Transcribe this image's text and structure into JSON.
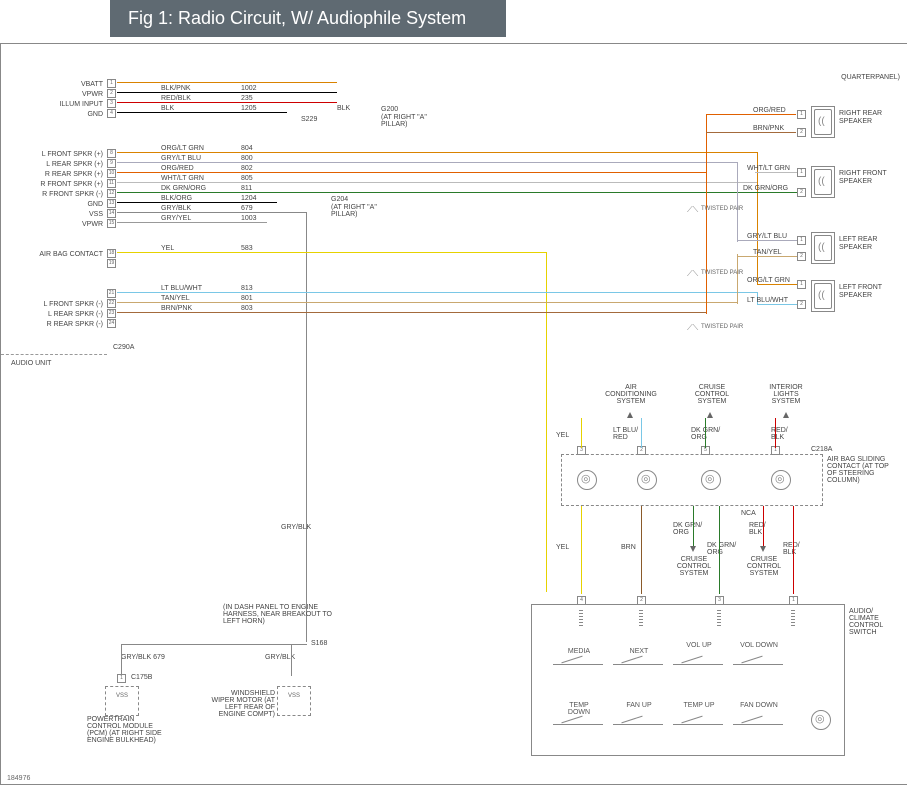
{
  "title": "Fig 1: Radio Circuit, W/ Audiophile System",
  "doc_id": "184976",
  "corner_label": "QUARTERPANEL)",
  "audio_unit_label": "AUDIO UNIT",
  "connector": "C290A",
  "left_pins": [
    {
      "num": "1",
      "name": "VBATT",
      "color": "",
      "code": ""
    },
    {
      "num": "2",
      "name": "VPWR",
      "color": "BLK/PNK",
      "code": "1002"
    },
    {
      "num": "3",
      "name": "ILLUM INPUT",
      "color": "RED/BLK",
      "code": "235"
    },
    {
      "num": "4",
      "name": "GND",
      "color": "BLK",
      "code": "1205"
    },
    {
      "num": "8",
      "name": "L FRONT SPKR (+)",
      "color": "ORG/LT GRN",
      "code": "804"
    },
    {
      "num": "9",
      "name": "L REAR SPKR (+)",
      "color": "GRY/LT BLU",
      "code": "800"
    },
    {
      "num": "10",
      "name": "R REAR SPKR (+)",
      "color": "ORG/RED",
      "code": "802"
    },
    {
      "num": "11",
      "name": "R FRONT SPKR (+)",
      "color": "WHT/LT GRN",
      "code": "805"
    },
    {
      "num": "12",
      "name": "R FRONT SPKR (-)",
      "color": "DK GRN/ORG",
      "code": "811"
    },
    {
      "num": "13",
      "name": "GND",
      "color": "BLK/ORG",
      "code": "1204"
    },
    {
      "num": "14",
      "name": "VSS",
      "color": "GRY/BLK",
      "code": "679"
    },
    {
      "num": "15",
      "name": "VPWR",
      "color": "GRY/YEL",
      "code": "1003"
    },
    {
      "num": "18",
      "name": "AIR BAG CONTACT",
      "color": "YEL",
      "code": "583"
    },
    {
      "num": "19",
      "name": "",
      "color": "",
      "code": ""
    },
    {
      "num": "21",
      "name": "",
      "color": "LT BLU/WHT",
      "code": "813"
    },
    {
      "num": "22",
      "name": "L FRONT SPKR (-)",
      "color": "TAN/YEL",
      "code": "801"
    },
    {
      "num": "23",
      "name": "L REAR SPKR (-)",
      "color": "BRN/PNK",
      "code": "803"
    },
    {
      "num": "24",
      "name": "R REAR SPKR (-)",
      "color": "",
      "code": ""
    }
  ],
  "splices": {
    "s229": "S229",
    "g200": "G200",
    "g200_loc": "(AT RIGHT \"A\" PILLAR)",
    "g204": "G204",
    "g204_loc": "(AT RIGHT \"A\" PILLAR)",
    "s168": "S168",
    "s168_loc": "(IN DASH PANEL TO ENGINE HARNESS, NEAR BREAKOUT TO LEFT HORN)"
  },
  "speakers": [
    {
      "name": "RIGHT REAR SPEAKER",
      "w1": "ORG/RED",
      "p1": "1",
      "w2": "BRN/PNK",
      "p2": "2"
    },
    {
      "name": "RIGHT FRONT SPEAKER",
      "w1": "WHT/LT GRN",
      "p1": "1",
      "w2": "DK GRN/ORG",
      "p2": "2"
    },
    {
      "name": "LEFT REAR SPEAKER",
      "w1": "GRY/LT BLU",
      "p1": "1",
      "w2": "TAN/YEL",
      "p2": "2"
    },
    {
      "name": "LEFT FRONT SPEAKER",
      "w1": "ORG/LT GRN",
      "p1": "1",
      "w2": "LT BLU/WHT",
      "p2": "2"
    }
  ],
  "twisted_label": "TWISTED PAIR",
  "systems": {
    "ac": "AIR CONDITIONING SYSTEM",
    "cc": "CRUISE CONTROL SYSTEM",
    "il": "INTERIOR LIGHTS SYSTEM"
  },
  "system_wires": {
    "yel": "YEL",
    "ltblu_red": "LT BLU/ RED",
    "dkgrn_org": "DK GRN/ ORG",
    "red_blk": "RED/ BLK",
    "brn": "BRN",
    "nca": "NCA",
    "gryblk": "GRY/BLK"
  },
  "c218a": "C218A",
  "airbag_block": "AIR BAG SLIDING CONTACT (AT TOP OF STEERING COLUMN)",
  "switch_block": "AUDIO/ CLIMATE CONTROL SWITCH",
  "switches": [
    "MEDIA",
    "NEXT",
    "VOL UP",
    "VOL DOWN",
    "TEMP DOWN",
    "FAN UP",
    "TEMP UP",
    "FAN DOWN"
  ],
  "vss_boxes": {
    "pcm": "POWERTRAIN CONTROL MODULE (PCM) (AT RIGHT SIDE ENGINE BULKHEAD)",
    "wiper": "WINDSHIELD WIPER MOTOR (AT LEFT REAR OF ENGINE COMPT)",
    "c175b": "C175B",
    "w_top": "GRY/BLK     679",
    "w_right": "GRY/BLK",
    "vss": "VSS"
  }
}
